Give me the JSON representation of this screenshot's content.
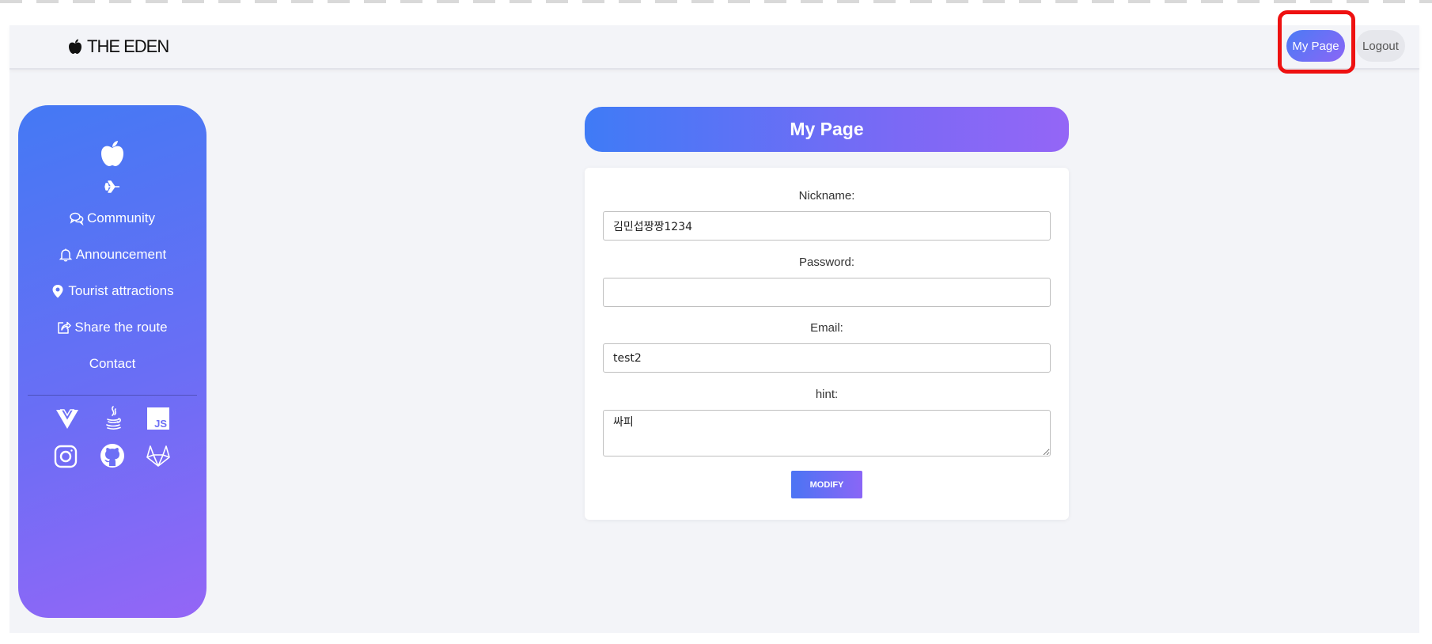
{
  "header": {
    "brand": "THE EDEN",
    "brand_icon": "apple-icon",
    "mypage_label": "My Page",
    "logout_label": "Logout",
    "highlight_color": "#ee1111"
  },
  "sidebar": {
    "logo_icon": "apple-icon",
    "top_icon": "plane-icon",
    "items": [
      {
        "label": "Community",
        "icon": "chat-bubbles-icon"
      },
      {
        "label": "Announcement",
        "icon": "bell-icon"
      },
      {
        "label": "Tourist attractions",
        "icon": "map-pin-icon"
      },
      {
        "label": "Share the route",
        "icon": "share-icon"
      },
      {
        "label": "Contact",
        "icon": ""
      }
    ],
    "tech_icons": [
      "vue-icon",
      "java-icon",
      "javascript-icon"
    ],
    "social_icons": [
      "instagram-icon",
      "github-icon",
      "gitlab-icon"
    ],
    "js_badge_text": "JS",
    "gradient": [
      "#4479f4",
      "#9466f6"
    ]
  },
  "main": {
    "title": "My Page",
    "form": {
      "nickname_label": "Nickname:",
      "nickname_value": "김민섭짱짱1234",
      "password_label": "Password:",
      "password_value": "",
      "email_label": "Email:",
      "email_value": "test2",
      "hint_label": "hint:",
      "hint_value": "싸피",
      "submit_label": "MODIFY"
    }
  }
}
